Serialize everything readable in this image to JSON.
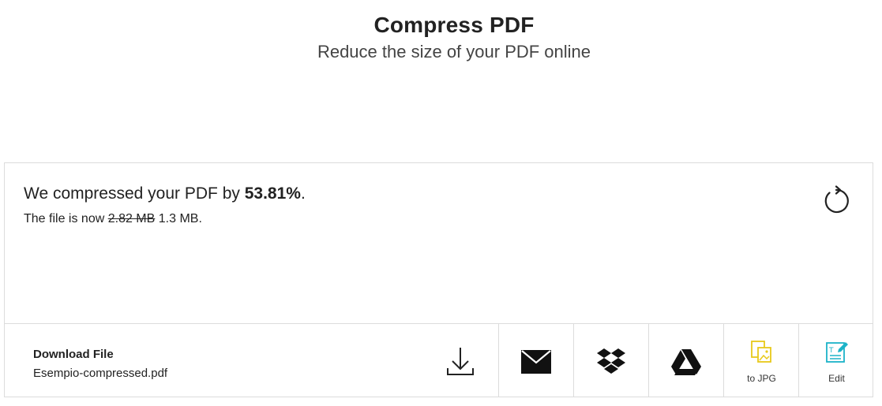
{
  "header": {
    "title": "Compress PDF",
    "subtitle": "Reduce the size of your PDF online"
  },
  "result": {
    "message_prefix": "We compressed your PDF by ",
    "percent": "53.81%",
    "message_suffix": ".",
    "size_prefix": "The file is now ",
    "old_size": "2.82 MB",
    "new_size": "1.3 MB",
    "size_suffix": "."
  },
  "download": {
    "title": "Download File",
    "filename": "Esempio-compressed.pdf"
  },
  "actions": {
    "to_jpg_label": "to JPG",
    "edit_label": "Edit"
  },
  "icons": {
    "restart": "restart-icon",
    "download": "download-icon",
    "email": "email-icon",
    "dropbox": "dropbox-icon",
    "google_drive": "google-drive-icon",
    "to_jpg": "jpg-image-icon",
    "edit": "edit-document-icon"
  },
  "colors": {
    "text": "#222222",
    "border": "#dcdcdc",
    "jpg_accent": "#e8c91a",
    "edit_accent": "#1cb3c8"
  }
}
